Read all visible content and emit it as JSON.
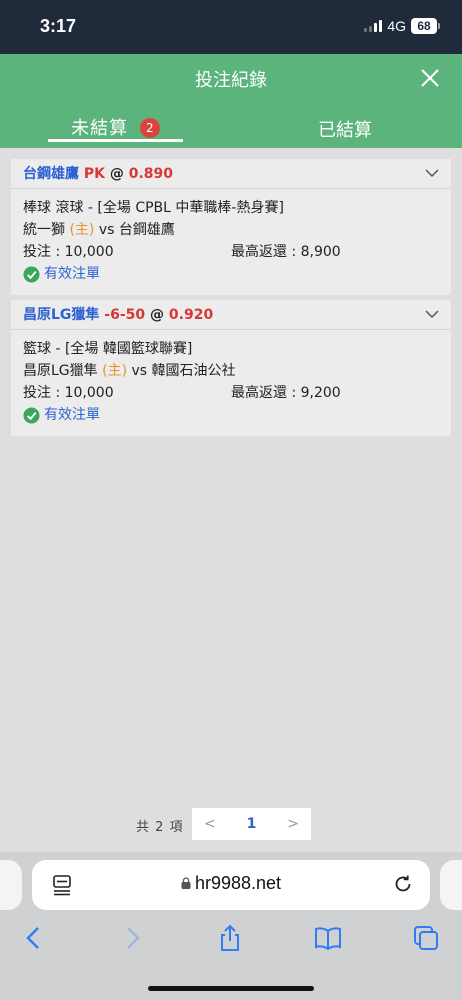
{
  "status_bar": {
    "time": "3:17",
    "network": "4G",
    "battery": "68"
  },
  "header": {
    "title": "投注紀錄"
  },
  "tabs": {
    "unsettled": {
      "label": "未結算",
      "badge": "2"
    },
    "settled": {
      "label": "已結算"
    }
  },
  "bets": [
    {
      "team": "台鋼雄鷹",
      "handicap": "PK",
      "at": "@",
      "odds": "0.890",
      "league_line": "棒球 滾球 - [全場 CPBL 中華職棒-熱身賽]",
      "home_team": "統一獅",
      "home_tag": "(主)",
      "vs": "vs",
      "away_team": "台鋼雄鷹",
      "stake": "投注 : 10,000",
      "max_return": "最高返還 : 8,900",
      "status": "有效注單"
    },
    {
      "team": "昌原LG獵隼",
      "handicap": "-6-50",
      "at": "@",
      "odds": "0.920",
      "league_line": "籃球 - [全場 韓國籃球聯賽]",
      "home_team": "昌原LG獵隼",
      "home_tag": "(主)",
      "vs": "vs",
      "away_team": "韓國石油公社",
      "stake": "投注 : 10,000",
      "max_return": "最高返還 : 9,200",
      "status": "有效注單"
    }
  ],
  "pagination": {
    "total": "共 2 項",
    "prev": "<",
    "current": "1",
    "next": ">"
  },
  "browser": {
    "url": "hr9988.net"
  },
  "colors": {
    "header_green": "#5bb47c",
    "badge_red": "#d9453a",
    "team_blue": "#2c63d1",
    "odds_red": "#d93636",
    "home_orange": "#e8922e",
    "valid_green": "#3aa65a"
  }
}
